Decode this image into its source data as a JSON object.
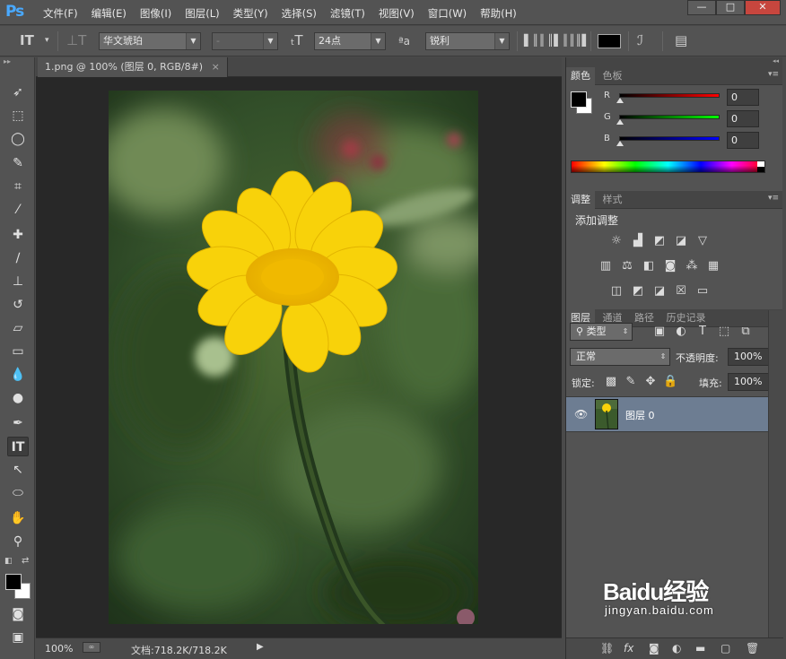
{
  "app": {
    "logo": "Ps"
  },
  "menu": [
    "文件(F)",
    "编辑(E)",
    "图像(I)",
    "图层(L)",
    "类型(Y)",
    "选择(S)",
    "滤镜(T)",
    "视图(V)",
    "窗口(W)",
    "帮助(H)"
  ],
  "window_controls": {
    "minimize": "—",
    "maximize": "□",
    "close": "✕"
  },
  "options": {
    "font_family": "华文琥珀",
    "font_style": "-",
    "font_size": "24点",
    "antialias_icon": "ªa",
    "antialias": "锐利",
    "text_color": "#000000"
  },
  "document": {
    "tab_title": "1.png @ 100% (图层 0, RGB/8#)",
    "tab_close": "×",
    "zoom": "100%",
    "doc_info": "文档:718.2K/718.2K",
    "status_arrow": "▶"
  },
  "color_panel": {
    "tabs": [
      "颜色",
      "色板"
    ],
    "channels": [
      {
        "label": "R",
        "value": "0",
        "gradient": "#ff0000"
      },
      {
        "label": "G",
        "value": "0",
        "gradient": "#00ff00"
      },
      {
        "label": "B",
        "value": "0",
        "gradient": "#0000ff"
      }
    ],
    "foreground": "#000000",
    "background": "#ffffff"
  },
  "adjustments_panel": {
    "tabs": [
      "调整",
      "样式"
    ],
    "heading": "添加调整"
  },
  "layers_panel": {
    "tabs": [
      "图层",
      "通道",
      "路径",
      "历史记录"
    ],
    "filter_kind": "类型",
    "blend_mode": "正常",
    "opacity_label": "不透明度:",
    "opacity_value": "100%",
    "lock_label": "锁定:",
    "fill_label": "填充:",
    "fill_value": "100%",
    "layers": [
      {
        "name": "图层 0",
        "visible": true,
        "selected": true
      }
    ]
  },
  "watermark": {
    "brand": "Baidu经验",
    "url": "jingyan.baidu.com"
  },
  "icons": {
    "type-tool": "type-icon",
    "move-tool": "move-icon",
    "marquee-tool": "rect-marquee-icon",
    "lasso-tool": "lasso-icon",
    "quick-select-tool": "quick-select-icon",
    "crop-tool": "crop-icon",
    "eyedropper-tool": "eyedropper-icon",
    "healing-tool": "healing-brush-icon",
    "brush-tool": "brush-icon",
    "stamp-tool": "clone-stamp-icon",
    "history-brush-tool": "history-brush-icon",
    "eraser-tool": "eraser-icon",
    "gradient-tool": "gradient-icon",
    "blur-tool": "blur-icon",
    "dodge-tool": "dodge-icon",
    "pen-tool": "pen-icon",
    "path-select-tool": "path-select-icon",
    "shape-tool": "ellipse-icon",
    "hand-tool": "hand-icon",
    "zoom-tool": "zoom-icon"
  }
}
